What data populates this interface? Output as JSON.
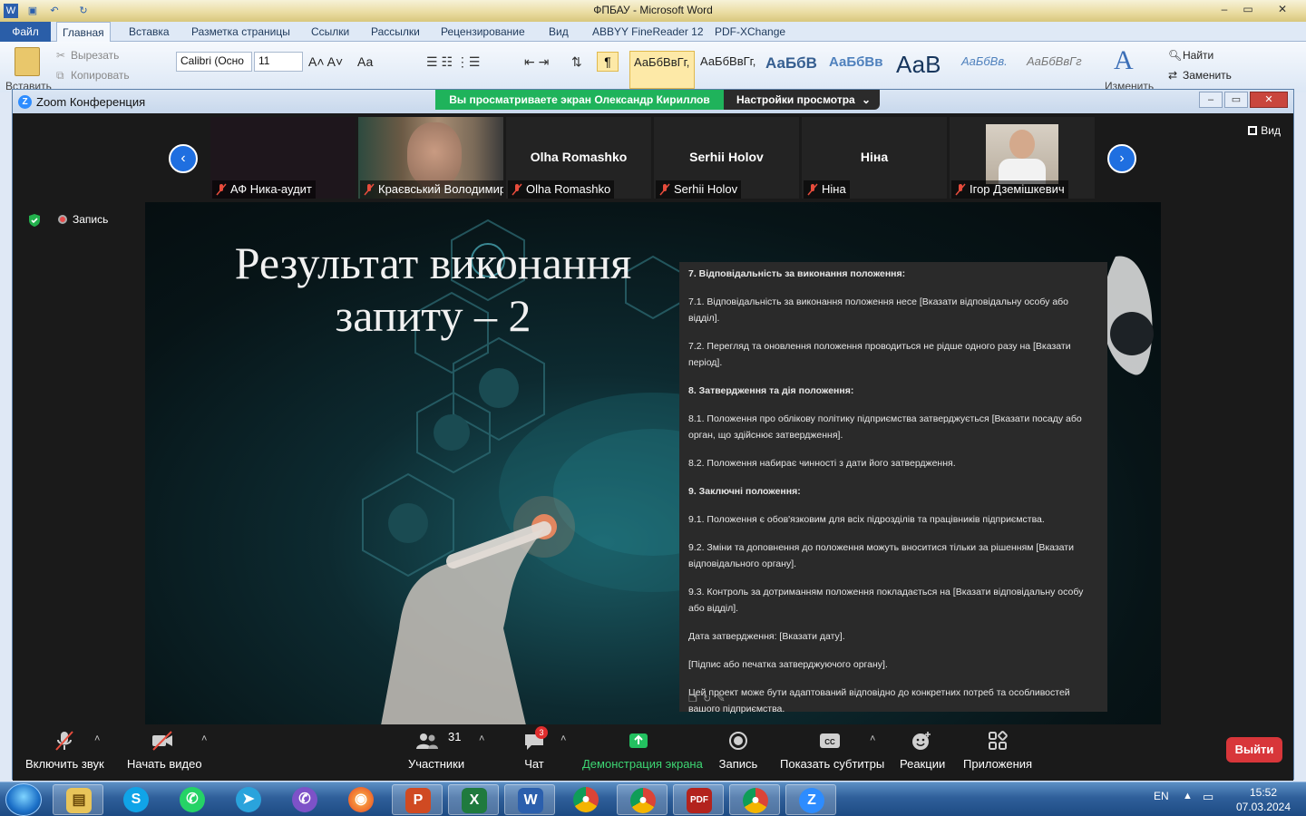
{
  "word": {
    "title": "ФПБАУ  -  Microsoft Word",
    "tabs": [
      "Файл",
      "Главная",
      "Вставка",
      "Разметка страницы",
      "Ссылки",
      "Рассылки",
      "Рецензирование",
      "Вид",
      "ABBYY FineReader 12",
      "PDF-XChange"
    ],
    "clipboard": {
      "paste": "Вставить",
      "cut": "Вырезать",
      "copy": "Копировать"
    },
    "font_name": "Calibri (Осно",
    "font_size": "11",
    "styles": [
      "АаБбВвГг,",
      "АаБбВвГг,",
      "АаБбВ",
      "АаБбВв",
      "АаВ",
      "АаБбВв.",
      "АаБбВвГг"
    ],
    "change_styles": "Изменить",
    "find": "Найти",
    "replace": "Заменить"
  },
  "zoom": {
    "window_title": "Zoom Конференция",
    "share_banner": "Вы просматриваете экран Олександр Кириллов",
    "view_settings": "Настройки просмотра",
    "view_button": "Вид",
    "recording": "Запись",
    "participants": [
      {
        "name": "АФ Ника-аудит",
        "muted": true
      },
      {
        "name": "Краєвський Володимир",
        "muted": true
      },
      {
        "name": "Olha Romashko",
        "muted": true,
        "center_name": "Olha Romashko"
      },
      {
        "name": "Serhii Holov",
        "muted": true,
        "center_name": "Serhii Holov"
      },
      {
        "name": "Ніна",
        "muted": true,
        "center_name": "Ніна"
      },
      {
        "name": "Ігор Дземішкевич",
        "muted": true
      }
    ],
    "slide": {
      "title_line1": "Результат виконання",
      "title_line2": "запиту – 2",
      "paragraphs": [
        {
          "text": "7. Відповідальність за виконання положення:",
          "bold": true
        },
        {
          "text": "7.1. Відповідальність за виконання положення несе [Вказати відповідальну особу або відділ].",
          "bold": false
        },
        {
          "text": "7.2. Перегляд та оновлення положення проводиться не рідше одного разу на [Вказати період].",
          "bold": false
        },
        {
          "text": "8. Затвердження та дія положення:",
          "bold": true
        },
        {
          "text": "8.1. Положення про облікову політику підприємства затверджується [Вказати посаду або орган, що здійснює затвердження].",
          "bold": false
        },
        {
          "text": "8.2. Положення набирає чинності з дати його затвердження.",
          "bold": false
        },
        {
          "text": "9. Заключні положення:",
          "bold": true
        },
        {
          "text": "9.1. Положення є обов'язковим для всіх підрозділів та працівників підприємства.",
          "bold": false
        },
        {
          "text": "9.2. Зміни та доповнення до положення можуть вноситися тільки за рішенням [Вказати відповідального органу].",
          "bold": false
        },
        {
          "text": "9.3. Контроль за дотриманням положення покладається на [Вказати відповідальну особу або відділ].",
          "bold": false
        },
        {
          "text": "Дата затвердження: [Вказати дату].",
          "bold": false
        },
        {
          "text": "[Підпис або печатка затверджуючого органу].",
          "bold": false
        },
        {
          "text": "Цей проект може бути адаптований відповідно до конкретних потреб та особливостей вашого підприємства.",
          "bold": false
        }
      ]
    },
    "toolbar": {
      "unmute": "Включить звук",
      "start_video": "Начать видео",
      "participants": "Участники",
      "participants_count": "31",
      "chat": "Чат",
      "chat_badge": "3",
      "share": "Демонстрация экрана",
      "record": "Запись",
      "captions": "Показать субтитры",
      "reactions": "Реакции",
      "apps": "Приложения",
      "leave": "Выйти"
    },
    "colors": {
      "share_green": "#1fb35b",
      "leave_red": "#d8363a",
      "nav_blue": "#1f6fe0"
    }
  },
  "taskbar": {
    "language": "EN",
    "time": "15:52",
    "date": "07.03.2024",
    "apps": [
      "explorer-icon",
      "skype-icon",
      "whatsapp-icon",
      "telegram-icon",
      "viber-icon",
      "firefox-icon",
      "powerpoint-icon",
      "excel-icon",
      "word-icon",
      "chrome-icon",
      "chrome-profile-icon",
      "pdf-xchange-icon",
      "chrome-profile-icon",
      "zoom-icon"
    ]
  }
}
